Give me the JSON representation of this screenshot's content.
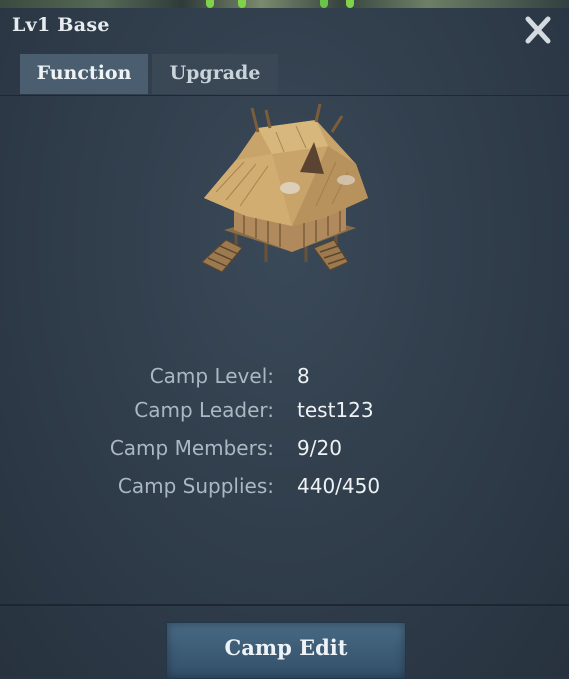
{
  "window": {
    "title": "Lv1 Base"
  },
  "tabs": [
    {
      "label": "Function",
      "active": true
    },
    {
      "label": "Upgrade",
      "active": false
    }
  ],
  "building": {
    "icon": "thatched-hut-base-icon"
  },
  "camp_info": [
    {
      "label": "Camp Level:",
      "value": "8"
    },
    {
      "label": "Camp Leader:",
      "value": "test123"
    },
    {
      "label": "Camp Members:",
      "value": "9/20"
    },
    {
      "label": "Camp Supplies:",
      "value": "440/450"
    }
  ],
  "actions": {
    "camp_edit_label": "Camp Edit"
  },
  "colors": {
    "panel_bg": "#2f3c4a",
    "tab_active": "#4b5e6f",
    "tab_inactive": "#3a4856",
    "label_text": "#a9b8c2",
    "value_text": "#eef2f4",
    "button_bg": "#3e5d77"
  }
}
